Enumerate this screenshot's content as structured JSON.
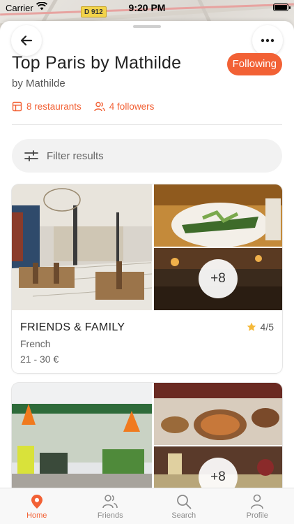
{
  "status_bar": {
    "carrier": "Carrier",
    "time": "9:20 PM"
  },
  "map": {
    "road_label": "D 912"
  },
  "header": {
    "title": "Top Paris by Mathilde",
    "byline": "by Mathilde",
    "follow_label": "Following",
    "restaurants_count": "8 restaurants",
    "followers_count": "4 followers"
  },
  "filter": {
    "placeholder": "Filter results"
  },
  "restaurants": [
    {
      "name": "FRIENDS & FAMILY",
      "cuisine": "French",
      "price": "21 - 30 €",
      "rating": "4/5",
      "more_photos": "+8"
    },
    {
      "more_photos": "+8"
    }
  ],
  "tabs": [
    {
      "label": "Home",
      "icon": "location-pin-icon",
      "active": true
    },
    {
      "label": "Friends",
      "icon": "friends-icon",
      "active": false
    },
    {
      "label": "Search",
      "icon": "search-icon",
      "active": false
    },
    {
      "label": "Profile",
      "icon": "profile-icon",
      "active": false
    }
  ],
  "colors": {
    "accent": "#f26135",
    "star": "#f5b93a"
  }
}
